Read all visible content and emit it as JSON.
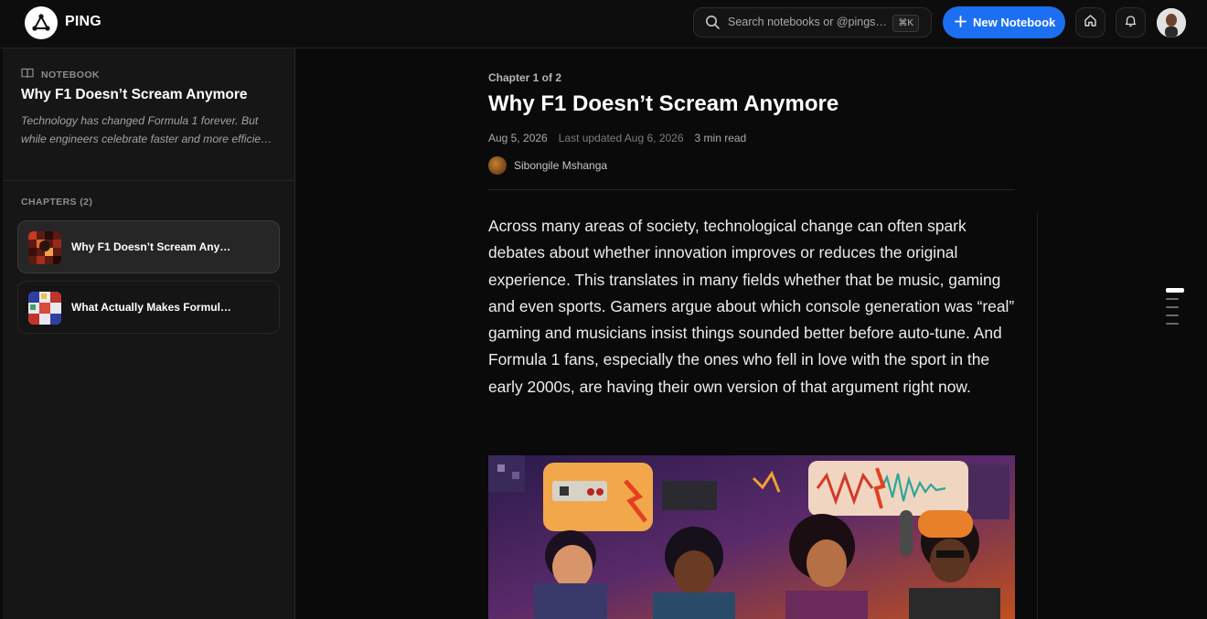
{
  "app": {
    "name": "PING"
  },
  "header": {
    "search_placeholder": "Search notebooks or @pings…",
    "search_shortcut": "⌘K",
    "new_button_label": "New Notebook"
  },
  "sidebar": {
    "notebook_label": "NOTEBOOK",
    "notebook_title": "Why F1 Doesn’t Scream Anymore",
    "notebook_desc_line1": "Technology has changed Formula 1 forever. But",
    "notebook_desc_line2": "while engineers celebrate faster and more efficie…",
    "chapters_label": "CHAPTERS (2)",
    "chapters": [
      {
        "title": "Why F1 Doesn’t Scream Any…",
        "active": true
      },
      {
        "title": "What Actually Makes Formul…",
        "active": false
      }
    ]
  },
  "article": {
    "chapter_of": "Chapter 1 of 2",
    "title": "Why F1 Doesn’t Scream Anymore",
    "date": "Aug 5, 2026",
    "updated": "Last updated Aug 6, 2026",
    "read_time": "3 min read",
    "author": "Sibongile Mshanga",
    "body": "Across many areas of society, technological change can often spark debates about whether innovation improves or reduces the original experience. This translates in many fields whether that be music, gaming and even sports. Gamers argue about which console generation was “real” gaming and musicians insist things sounded better before auto-tune. And Formula 1 fans, especially the ones who fell in love with the sport in the early 2000s, are having their own version of that argument right now."
  },
  "colors": {
    "accent": "#1d6ff2",
    "background": "#0b0b0b",
    "sidebar": "#161616"
  }
}
